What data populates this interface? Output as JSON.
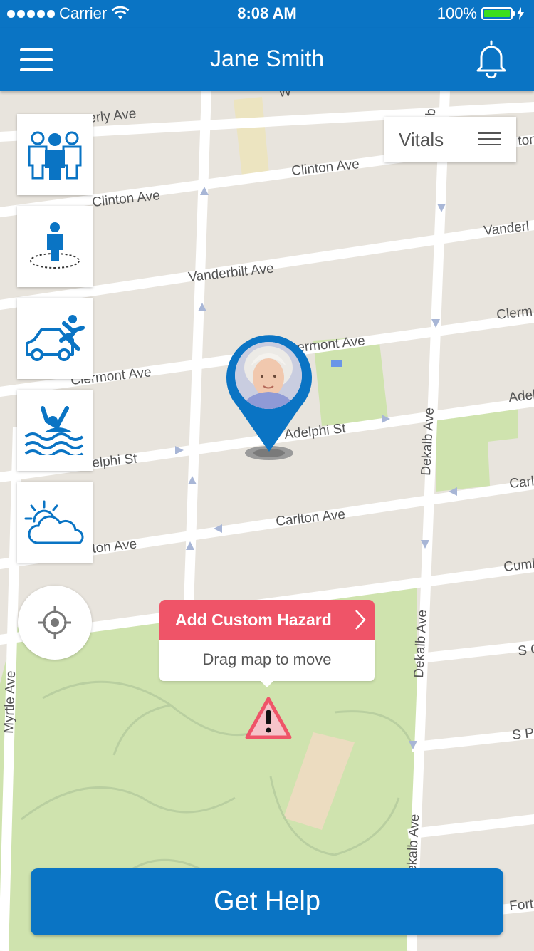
{
  "status_bar": {
    "carrier": "Carrier",
    "time": "8:08 AM",
    "battery_text": "100%",
    "battery_level": 1.0,
    "battery_color": "#3dde1e"
  },
  "header": {
    "title": "Jane Smith",
    "menu_icon": "hamburger-menu-icon",
    "notification_icon": "bell-icon"
  },
  "map": {
    "streets": [
      "erly Ave",
      "Clinton Ave",
      "Clinton Ave",
      "Vanderbilt Ave",
      "Vanderl",
      "Clermont Ave",
      "ermont Ave",
      "Clerm",
      "Adelphi St",
      "elphi St",
      "Adel",
      "Carlton Ave",
      "ton Ave",
      "Carl",
      "Cuml",
      "Dekalb Ave",
      "Dekalb Ave",
      "ekalb Ave",
      "Myrtle Ave",
      "S O",
      "S Po",
      "Fort",
      "alb",
      "W",
      "ton"
    ]
  },
  "hazard_buttons": [
    {
      "icon": "group-icon"
    },
    {
      "icon": "person-geofence-icon"
    },
    {
      "icon": "car-accident-icon"
    },
    {
      "icon": "drowning-icon"
    },
    {
      "icon": "weather-icon"
    }
  ],
  "locate_icon": "crosshair-icon",
  "vitals": {
    "label": "Vitals",
    "icon": "list-icon"
  },
  "hazard_popup": {
    "action_label": "Add Custom Hazard",
    "hint": "Drag map to move",
    "marker_icon": "warning-icon"
  },
  "person_pin": {
    "icon": "location-pin-icon"
  },
  "get_help": {
    "label": "Get Help"
  },
  "colors": {
    "primary": "#0a74c4",
    "accent": "#ef5468",
    "park": "#cfe3ae",
    "map_bg": "#e8e4dd"
  }
}
